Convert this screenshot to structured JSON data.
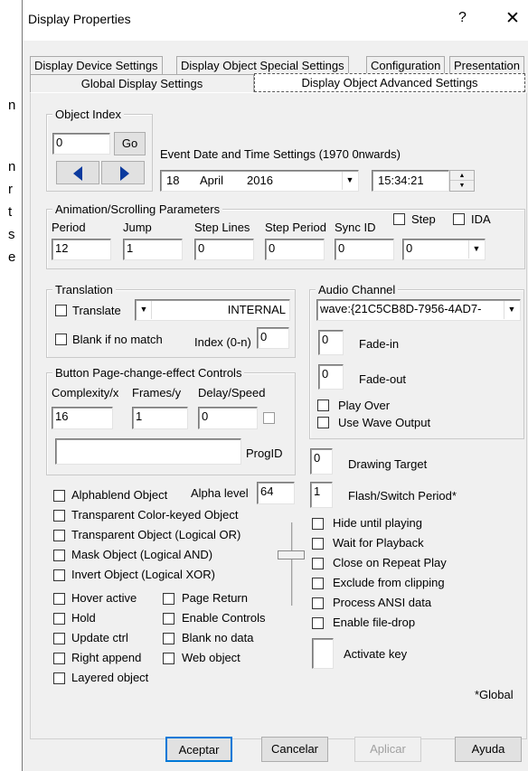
{
  "background": {
    "lines": [
      "n",
      "n",
      "r",
      "t",
      "s",
      "e"
    ]
  },
  "window": {
    "title": "Display Properties",
    "help": "?",
    "close": "✕"
  },
  "tabs": {
    "row1": [
      "Display Device Settings",
      "Display Object Special Settings",
      "Configuration",
      "Presentation"
    ],
    "row2": [
      "Global Display Settings",
      "Display Object Advanced Settings"
    ]
  },
  "object_index": {
    "legend": "Object Index",
    "value": "0",
    "go": "Go",
    "prev_icon": "left-triangle-icon",
    "next_icon": "right-triangle-icon"
  },
  "event": {
    "label": "Event Date and Time Settings (1970 0nwards)",
    "day": "18",
    "month": "April",
    "year": "2016",
    "time": "15:34:21"
  },
  "animation": {
    "legend": "Animation/Scrolling Parameters",
    "period_label": "Period",
    "period": "12",
    "jump_label": "Jump",
    "jump": "1",
    "step_lines_label": "Step Lines",
    "step_lines": "0",
    "step_period_label": "Step Period",
    "step_period": "0",
    "sync_id_label": "Sync ID",
    "sync_id": "0",
    "step_label": "Step",
    "ida_label": "IDA",
    "sync_select": "0"
  },
  "translation": {
    "legend": "Translation",
    "translate_label": "Translate",
    "mode": "INTERNAL",
    "blank_label": "Blank if no match",
    "index_label": "Index (0-n)",
    "index": "0"
  },
  "audio": {
    "legend": "Audio Channel",
    "device": "wave:{21C5CB8D-7956-4AD7-",
    "fadein_value": "0",
    "fadein_label": "Fade-in",
    "fadeout_value": "0",
    "fadeout_label": "Fade-out",
    "play_over": "Play Over",
    "use_wave": "Use Wave Output"
  },
  "buttons_group": {
    "legend": "Button Page-change-effect Controls",
    "complexity_label": "Complexity/x",
    "complexity": "16",
    "frames_label": "Frames/y",
    "frames": "1",
    "delay_label": "Delay/Speed",
    "delay": "0",
    "progid_label": "ProgID",
    "progid": ""
  },
  "drawing_target": {
    "value": "0",
    "label": "Drawing Target"
  },
  "flash": {
    "value": "1",
    "label": "Flash/Switch Period*"
  },
  "alpha": {
    "label": "Alpha level",
    "value": "64"
  },
  "checks_left": [
    "Alphablend Object",
    "Transparent Color-keyed Object",
    "Transparent Object (Logical OR)",
    "Mask Object (Logical AND)",
    "Invert Object (Logical XOR)"
  ],
  "checks_col_a": [
    "Hover active",
    "Hold",
    "Update ctrl",
    "Right append",
    "Layered object"
  ],
  "checks_col_b": [
    "Page Return",
    "Enable Controls",
    "Blank no data",
    "Web object"
  ],
  "checks_right": [
    "Hide until playing",
    "Wait for Playback",
    "Close on Repeat Play",
    "Exclude from clipping",
    "Process ANSI data",
    "Enable file-drop"
  ],
  "activate_key": "Activate key",
  "global_note": "*Global",
  "footer": {
    "ok": "Aceptar",
    "cancel": "Cancelar",
    "apply": "Aplicar",
    "help": "Ayuda"
  }
}
